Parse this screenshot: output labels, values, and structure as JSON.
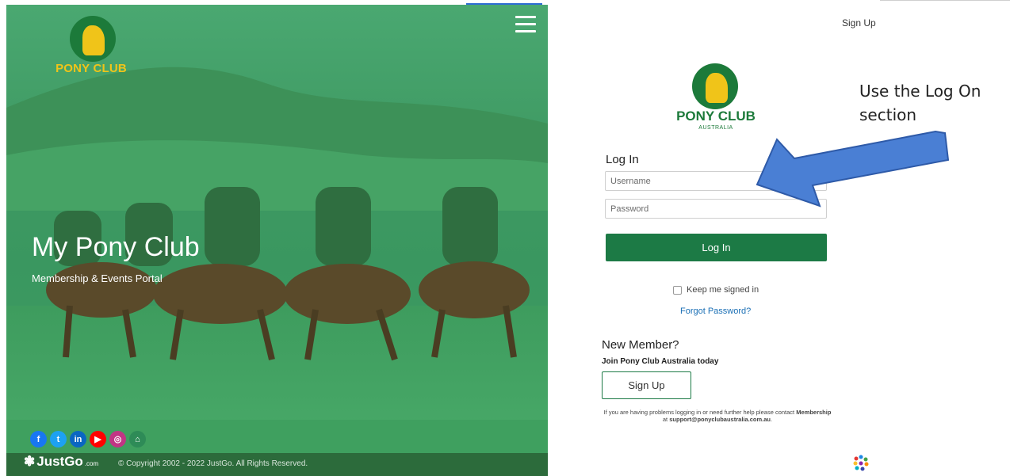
{
  "hero": {
    "brand": "PONY CLUB",
    "title": "My Pony Club",
    "subtitle": "Membership & Events Portal",
    "social_icons": [
      "facebook-icon",
      "twitter-icon",
      "linkedin-icon",
      "youtube-icon",
      "instagram-icon",
      "home-icon"
    ],
    "social_labels": [
      "f",
      "t",
      "in",
      "▶",
      "◎",
      "⌂"
    ],
    "social_colors": [
      "#1877f2",
      "#1da1f2",
      "#0a66c2",
      "#ff0000",
      "#c13584",
      "#2e8b57"
    ],
    "footer_logo": "JustGo",
    "footer_logo_suffix": ".com",
    "copyright": "© Copyright 2002 - 2022 JustGo. All Rights Reserved."
  },
  "header": {
    "signup_link": "Sign Up"
  },
  "right_logo": {
    "brand": "PONY CLUB",
    "country": "AUSTRALIA"
  },
  "login": {
    "heading": "Log In",
    "username_placeholder": "Username",
    "password_placeholder": "Password",
    "button": "Log In",
    "keep_signed_in": "Keep me signed in",
    "forgot_password": "Forgot Password?"
  },
  "new_member": {
    "heading": "New Member?",
    "subheading": "Join Pony Club Australia today",
    "button": "Sign Up",
    "help_pre": "If you are having problems logging in or need further help please contact",
    "help_contact": "Membership",
    "help_mid": "at",
    "help_email": "support@ponyclubaustralia.com.au",
    "help_post": "."
  },
  "annotation": {
    "line1": "Use the Log On",
    "line2": "section"
  },
  "colors": {
    "brand_green": "#1c7a45",
    "brand_yellow": "#f0c419",
    "link_blue": "#1a6fb5",
    "arrow_blue": "#4a7fd4"
  }
}
